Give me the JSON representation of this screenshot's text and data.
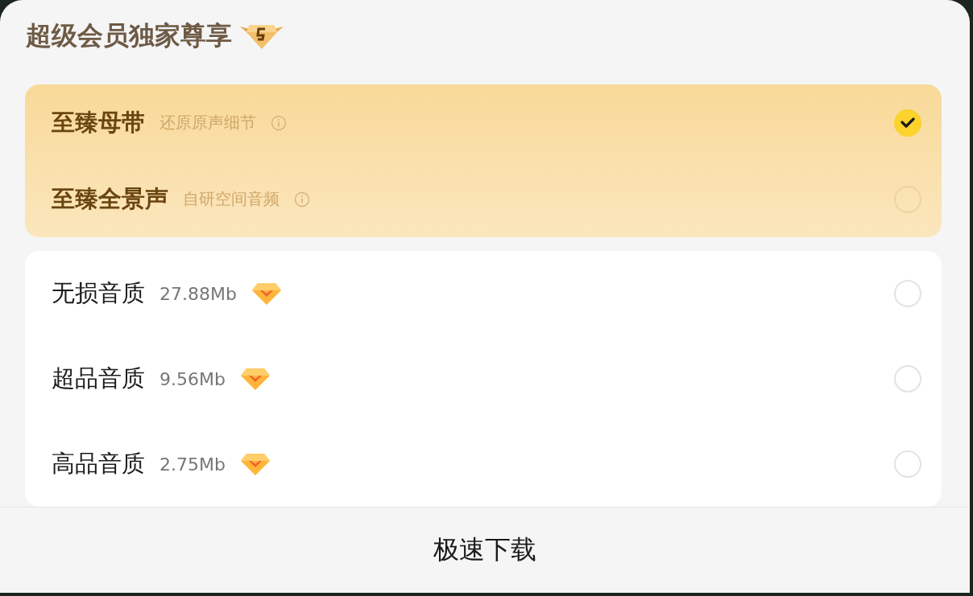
{
  "title": "超级会员独家尊享",
  "premium_options": [
    {
      "name": "至臻母带",
      "description": "还原原声细节",
      "selected": true
    },
    {
      "name": "至臻全景声",
      "description": "自研空间音频",
      "selected": false
    }
  ],
  "quality_options": [
    {
      "name": "无损音质",
      "size": "27.88Mb",
      "selected": false
    },
    {
      "name": "超品音质",
      "size": "9.56Mb",
      "selected": false
    },
    {
      "name": "高品音质",
      "size": "2.75Mb",
      "selected": false
    }
  ],
  "download_button": "极速下载"
}
